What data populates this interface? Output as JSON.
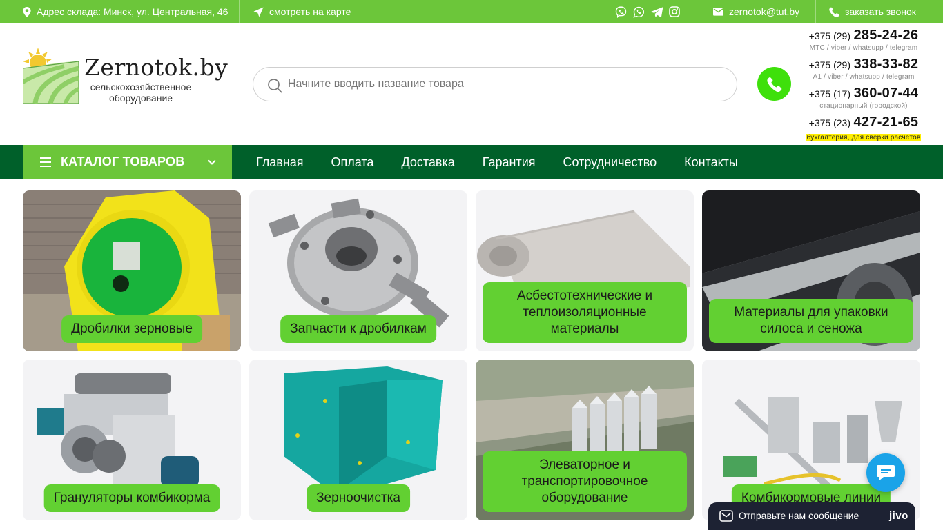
{
  "topbar": {
    "address": "Адрес склада: Минск, ул. Центральная, 46",
    "map_link": "смотреть на карте",
    "email": "zernotok@tut.by",
    "callback": "заказать звонок",
    "socials": [
      "viber-icon",
      "whatsapp-icon",
      "telegram-icon",
      "instagram-icon"
    ]
  },
  "header": {
    "brand": "Zernotok.by",
    "tagline": "сельскохозяйственное оборудование",
    "search_placeholder": "Начните вводить название товара"
  },
  "phones": [
    {
      "prefix": "+375 (29)",
      "number": "285-24-26",
      "note": "МТС / viber / whatsupp / telegram",
      "highlight": false
    },
    {
      "prefix": "+375 (29)",
      "number": "338-33-82",
      "note": "A1 / viber / whatsupp / telegram",
      "highlight": false
    },
    {
      "prefix": "+375 (17)",
      "number": "360-07-44",
      "note": "стационарный (городской)",
      "highlight": false
    },
    {
      "prefix": "+375 (23)",
      "number": "427-21-65",
      "note": "бухгалтерия, для сверки расчётов",
      "highlight": true
    }
  ],
  "nav": {
    "catalog_label": "КАТАЛОГ ТОВАРОВ",
    "links": [
      "Главная",
      "Оплата",
      "Доставка",
      "Гарантия",
      "Сотрудничество",
      "Контакты"
    ]
  },
  "categories": [
    {
      "label": "Дробилки зерновые"
    },
    {
      "label": "Запчасти к дробилкам"
    },
    {
      "label": "Асбестотехнические и теплоизоляционные материалы"
    },
    {
      "label": "Материалы для упаковки силоса и сеножа"
    },
    {
      "label": "Грануляторы комбикорма"
    },
    {
      "label": "Зерноочистка"
    },
    {
      "label": "Элеваторное и транспортировочное оборудование"
    },
    {
      "label": "Комбикормовые линии"
    }
  ],
  "chat": {
    "message": "Отправьте нам сообщение",
    "brand": "jivo"
  },
  "colors": {
    "topbar": "#6cc63a",
    "nav": "#00602a",
    "label_bg": "#62d032",
    "call_button": "#3ee00b",
    "chat_bubble": "#1aa3e8",
    "jivo_bar": "#1d2233",
    "highlight": "#ffee00"
  }
}
